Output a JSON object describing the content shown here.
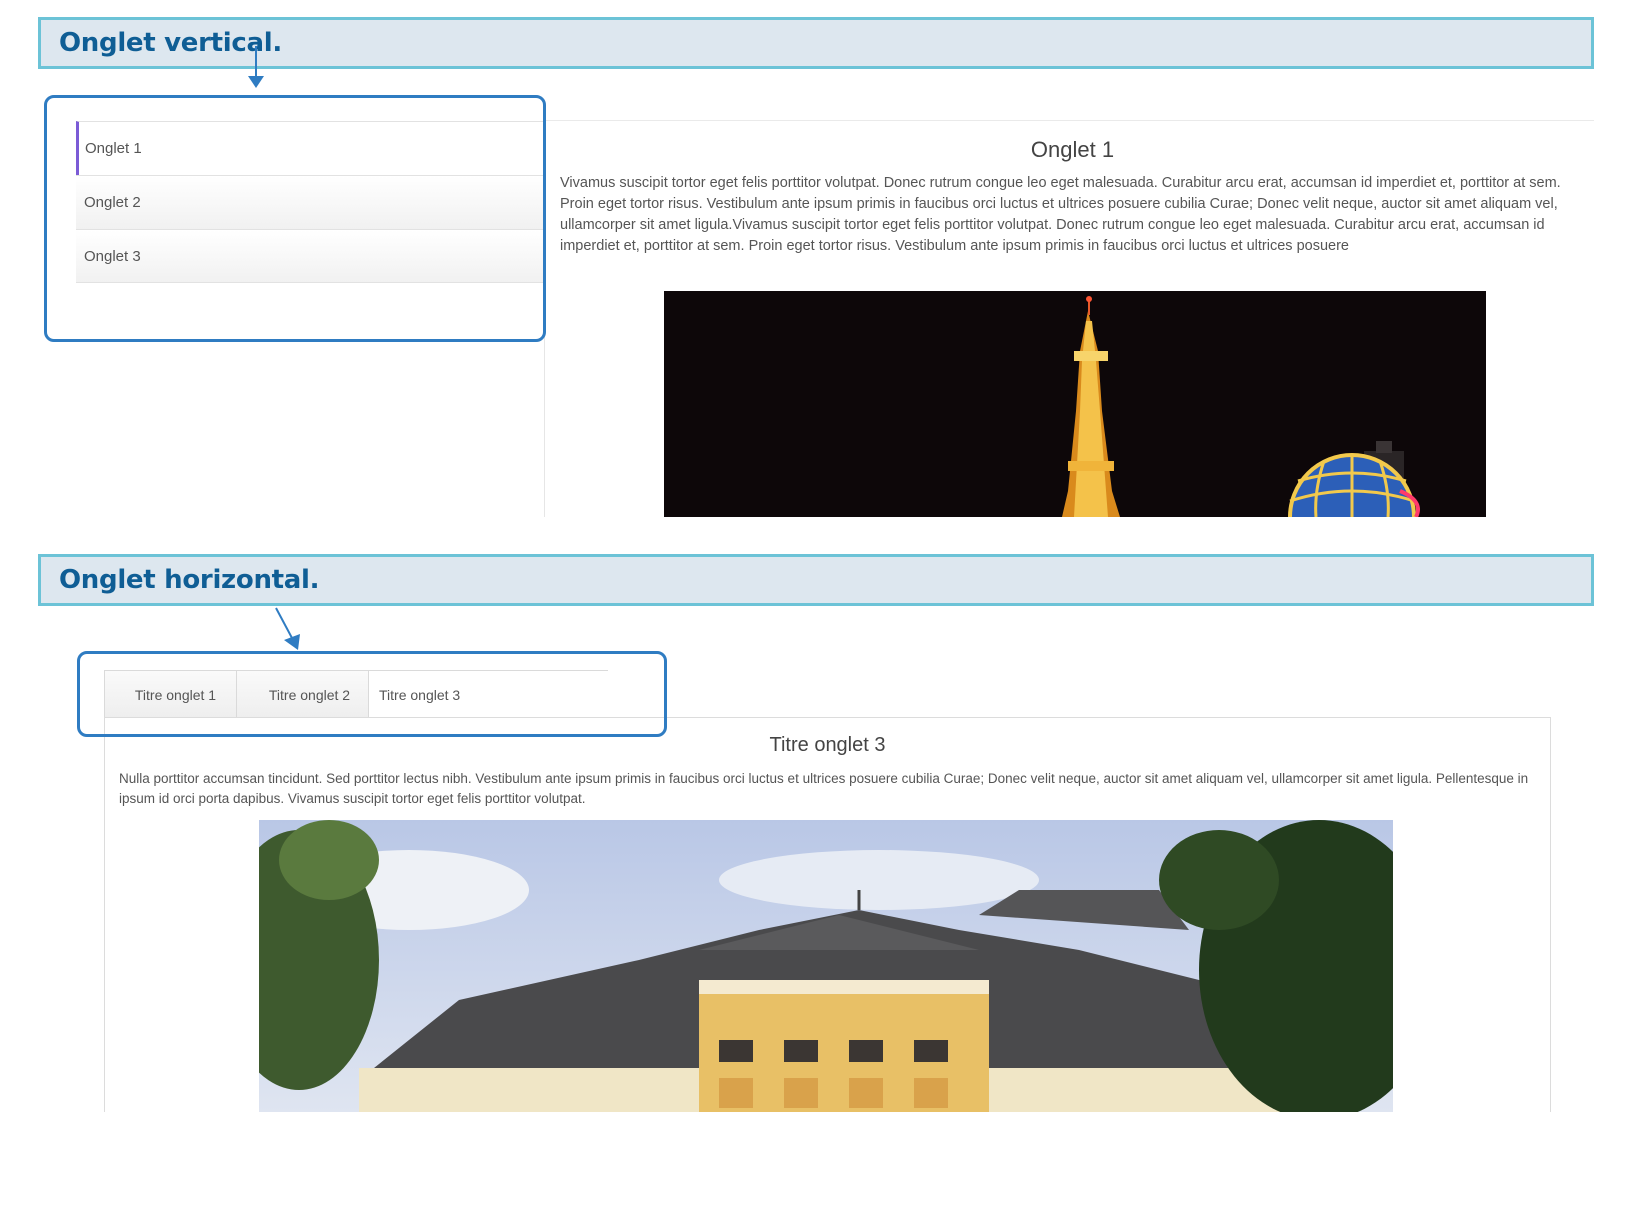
{
  "vertical_section": {
    "heading": "Onglet vertical.",
    "tabs": [
      {
        "label": "Onglet 1",
        "active": true
      },
      {
        "label": "Onglet 2",
        "active": false
      },
      {
        "label": "Onglet 3",
        "active": false
      }
    ],
    "panel": {
      "title": "Onglet 1",
      "text": "Vivamus suscipit tortor eget felis porttitor volutpat. Donec rutrum congue leo eget malesuada. Curabitur arcu erat, accumsan id imperdiet et, porttitor at sem. Proin eget tortor risus. Vestibulum ante ipsum primis in faucibus orci luctus et ultrices posuere cubilia Curae; Donec velit neque, auctor sit amet aliquam vel, ullamcorper sit amet ligula.Vivamus suscipit tortor eget felis porttitor volutpat. Donec rutrum congue leo eget malesuada. Curabitur arcu erat, accumsan id imperdiet et, porttitor at sem. Proin eget tortor risus. Vestibulum ante ipsum primis in faucibus orci luctus et ultrices posuere",
      "image": "night-eiffel-tower-photo"
    }
  },
  "horizontal_section": {
    "heading": "Onglet horizontal.",
    "tabs": [
      {
        "label": "Titre onglet 1",
        "active": false
      },
      {
        "label": "Titre onglet 2",
        "active": false
      },
      {
        "label": "Titre onglet 3",
        "active": true
      }
    ],
    "panel": {
      "title": "Titre onglet 3",
      "text": "Nulla porttitor accumsan tincidunt. Sed porttitor lectus nibh. Vestibulum ante ipsum primis in faucibus orci luctus et ultrices posuere cubilia Curae; Donec velit neque, auctor sit amet aliquam vel, ullamcorper sit amet ligula. Pellentesque in ipsum id orci porta dapibus. Vivamus suscipit tortor eget felis porttitor volutpat.",
      "image": "yellow-building-photo"
    }
  },
  "colors": {
    "banner_bg": "#dde7ef",
    "banner_border": "#6cc3d7",
    "heading_text": "#0f5e95",
    "callout": "#2f7cc2",
    "active_tab_marker": "#7b5bd6"
  }
}
